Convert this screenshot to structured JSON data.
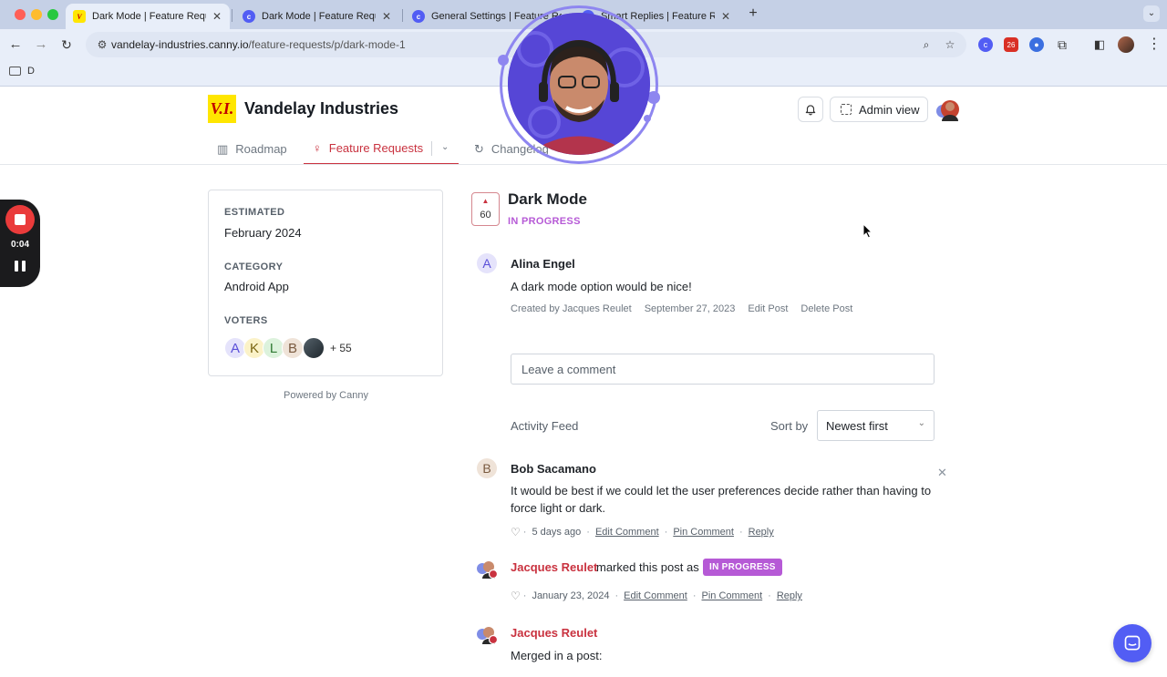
{
  "browser": {
    "tabs": [
      {
        "title": "Dark Mode | Feature Requests",
        "favicon": "vi-logo-icon",
        "active": true
      },
      {
        "title": "Dark Mode | Feature Requests",
        "favicon": "canny-icon",
        "active": false
      },
      {
        "title": "General Settings | Feature Requests",
        "favicon": "canny-icon",
        "active": false
      },
      {
        "title": "Smart Replies | Feature Requests",
        "favicon": "canny-icon",
        "active": false
      }
    ],
    "url_domain": "vandelay-industries.canny.io",
    "url_path": "/feature-requests/p/dark-mode-1",
    "bookmark": "D",
    "badge_count": "26"
  },
  "header": {
    "logo_text": "V.I.",
    "company": "Vandelay Industries",
    "admin_view": "Admin view"
  },
  "nav": {
    "roadmap": "Roadmap",
    "feature_requests": "Feature Requests",
    "changelog": "Changelog"
  },
  "sidebar": {
    "estimated_label": "ESTIMATED",
    "estimated_value": "February 2024",
    "category_label": "CATEGORY",
    "category_value": "Android App",
    "voters_label": "VOTERS",
    "voters": [
      "A",
      "K",
      "L",
      "B"
    ],
    "voters_more": "+ 55",
    "powered_by": "Powered by Canny"
  },
  "post": {
    "votes": "60",
    "title": "Dark Mode",
    "status": "IN PROGRESS",
    "author_initial": "A",
    "author": "Alina Engel",
    "body": "A dark mode option would be nice!",
    "created_by": "Created by Jacques Reulet",
    "date": "September 27, 2023",
    "edit": "Edit Post",
    "delete": "Delete Post"
  },
  "comment_input": {
    "placeholder": "Leave a comment"
  },
  "feed": {
    "title": "Activity Feed",
    "sort_label": "Sort by",
    "sort_value": "Newest first"
  },
  "comments": [
    {
      "initial": "B",
      "author": "Bob Sacamano",
      "body_line1": "It would be best if we could let the user preferences decide rather than having to",
      "body_line2": "force light or dark.",
      "time": "5 days ago",
      "edit": "Edit Comment",
      "pin": "Pin Comment",
      "reply": "Reply"
    },
    {
      "author": "Jacques Reulet",
      "action": "marked this post as",
      "status": "IN PROGRESS",
      "time": "January 23, 2024",
      "edit": "Edit Comment",
      "pin": "Pin Comment",
      "reply": "Reply"
    },
    {
      "author": "Jacques Reulet",
      "body": "Merged in a post:"
    }
  ],
  "recording": {
    "time": "0:04"
  },
  "colors": {
    "brand_red": "#c9323f",
    "status_purple": "#b65ad6",
    "canny_blue": "#525df4",
    "logo_yellow": "#ffe600"
  }
}
